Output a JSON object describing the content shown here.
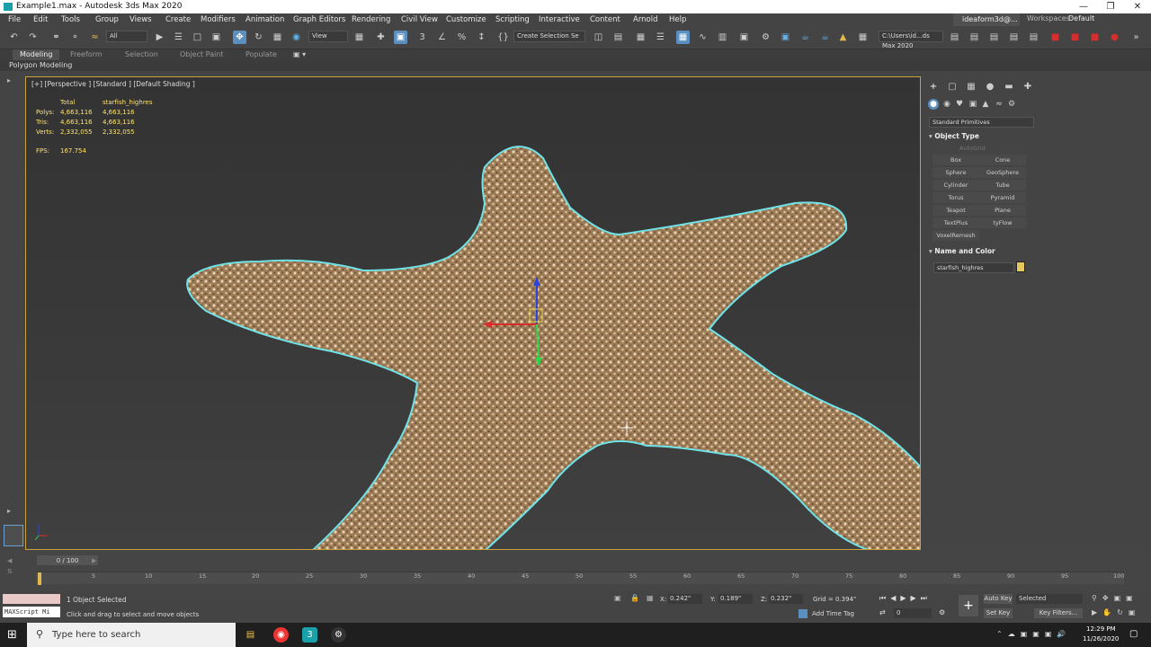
{
  "window": {
    "title": "Example1.max - Autodesk 3ds Max 2020"
  },
  "menu": [
    "File",
    "Edit",
    "Tools",
    "Group",
    "Views",
    "Create",
    "Modifiers",
    "Animation",
    "Graph Editors",
    "Rendering",
    "Civil View",
    "Customize",
    "Scripting",
    "Interactive",
    "Content",
    "Arnold",
    "Help"
  ],
  "account": {
    "user": "ideaform3d@...",
    "workspaces_label": "Workspaces:",
    "workspace": "Default"
  },
  "toolbar": {
    "filter": "All",
    "view": "View",
    "selection_set": "Create Selection Se",
    "path": "C:\\Users\\id...ds Max 2020"
  },
  "ribbon": {
    "tabs": [
      "Modeling",
      "Freeform",
      "Selection",
      "Object Paint",
      "Populate"
    ],
    "active_tab": "Modeling",
    "subpanel": "Polygon Modeling"
  },
  "viewport": {
    "label": "[+] [Perspective ] [Standard ] [Default Shading ]",
    "stats": {
      "col_total": "Total",
      "col_object": "starfish_highres",
      "polys_label": "Polys:",
      "polys_total": "4,663,116",
      "polys_obj": "4,663,116",
      "tris_label": "Tris:",
      "tris_total": "4,663,116",
      "tris_obj": "4,663,116",
      "verts_label": "Verts:",
      "verts_total": "2,332,055",
      "verts_obj": "2,332,055",
      "fps_label": "FPS:",
      "fps": "167.754"
    }
  },
  "command_panel": {
    "category": "Standard Primitives",
    "object_type_title": "Object Type",
    "autogrid": "AutoGrid",
    "buttons": [
      "Box",
      "Cone",
      "Sphere",
      "GeoSphere",
      "Cylinder",
      "Tube",
      "Torus",
      "Pyramid",
      "Teapot",
      "Plane",
      "TextPlus",
      "tyFlow",
      "VoxelRemesh"
    ],
    "name_color_title": "Name and Color",
    "object_name": "starfish_highres",
    "object_color": "#e3c85e"
  },
  "timeline": {
    "current": "0 / 100",
    "ticks": [
      "0",
      "5",
      "10",
      "15",
      "20",
      "25",
      "30",
      "35",
      "40",
      "45",
      "50",
      "55",
      "60",
      "65",
      "70",
      "75",
      "80",
      "85",
      "90",
      "95",
      "100"
    ]
  },
  "status": {
    "maxscript": "MAXScript Mi",
    "selected": "1 Object Selected",
    "prompt": "Click and drag to select and move objects",
    "x_label": "X:",
    "x": "0.242\"",
    "y_label": "Y:",
    "y": "0.189\"",
    "z_label": "Z:",
    "z": "0.232\"",
    "grid": "Grid = 0.394\"",
    "add_time_tag": "Add Time Tag",
    "auto_key": "Auto Key",
    "set_key": "Set Key",
    "key_mode": "Selected",
    "key_filters": "Key Filters...",
    "frame": "0"
  },
  "taskbar": {
    "search_placeholder": "Type here to search",
    "time": "12:29 PM",
    "date": "11/26/2020"
  }
}
